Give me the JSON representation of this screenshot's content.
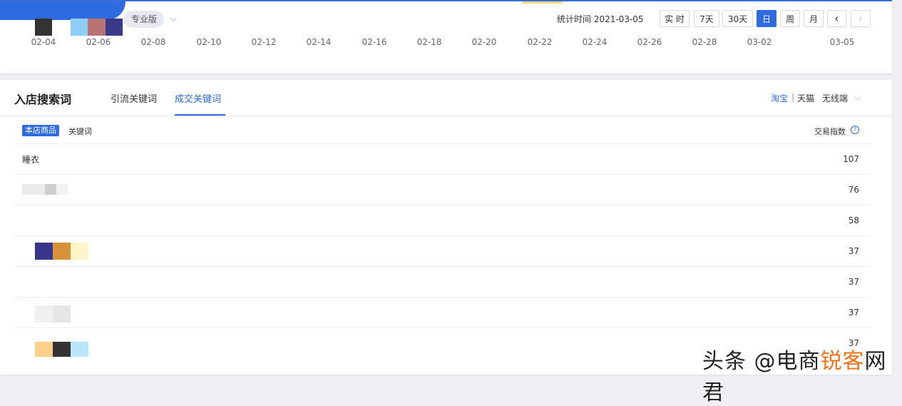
{
  "header": {
    "badge": "专业版",
    "stat_label": "统计时间 2021-03-05",
    "buttons": [
      {
        "label": "实 时"
      },
      {
        "label": "7天"
      },
      {
        "label": "30天"
      },
      {
        "label": "日",
        "active": true
      },
      {
        "label": "周"
      },
      {
        "label": "月"
      }
    ],
    "prev_icon": "‹",
    "next_icon": "›",
    "dropdown_icon": "⌵"
  },
  "x_axis": [
    "02-04",
    "02-06",
    "02-08",
    "02-10",
    "02-12",
    "02-14",
    "02-16",
    "02-18",
    "02-20",
    "02-22",
    "02-24",
    "02-26",
    "02-28",
    "03-02",
    "03-05"
  ],
  "panel": {
    "title": "入店搜索词",
    "tabs": [
      "引流关键词",
      "成交关键词"
    ],
    "platforms": {
      "taobao": "淘宝",
      "separator": "|",
      "tmall": "天猫"
    },
    "device": "无线端",
    "device_chevron": "⌵",
    "tag": "本店商品",
    "col_keyword": "关键词",
    "col_index": "交易指数",
    "help_icon": "?",
    "rows": [
      {
        "name": "睡衣",
        "value": "107"
      },
      {
        "name": "",
        "value": "76"
      },
      {
        "name": "",
        "value": "58"
      },
      {
        "name": "",
        "value": "37"
      },
      {
        "name": "",
        "value": "37"
      },
      {
        "name": "",
        "value": "37"
      },
      {
        "name": "",
        "value": "37"
      }
    ]
  },
  "watermark": {
    "prefix": "头条 @电商",
    "accent": "锐客",
    "suffix": "网君"
  },
  "colors": {
    "accent": "#2f6be0"
  }
}
